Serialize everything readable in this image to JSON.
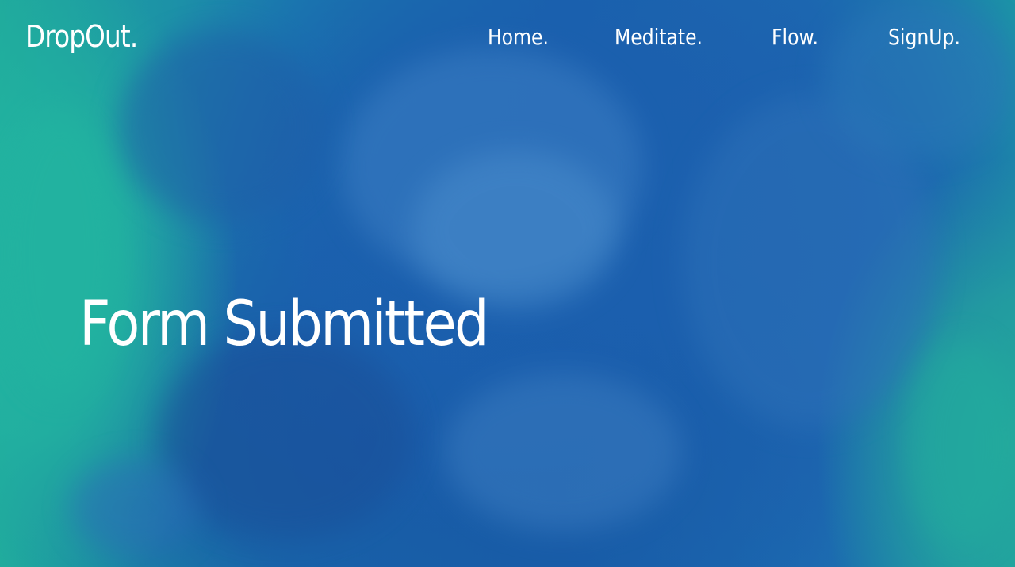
{
  "brand": {
    "name": "DropOut."
  },
  "nav": {
    "items": [
      {
        "label": "Home."
      },
      {
        "label": "Meditate."
      },
      {
        "label": "Flow."
      },
      {
        "label": "SignUp."
      }
    ]
  },
  "hero": {
    "title": "Form Submitted",
    "background": "blue-ink-in-water-image"
  },
  "colors": {
    "text": "#ffffff",
    "teal": "#1fa99c",
    "blue": "#1862ac"
  }
}
